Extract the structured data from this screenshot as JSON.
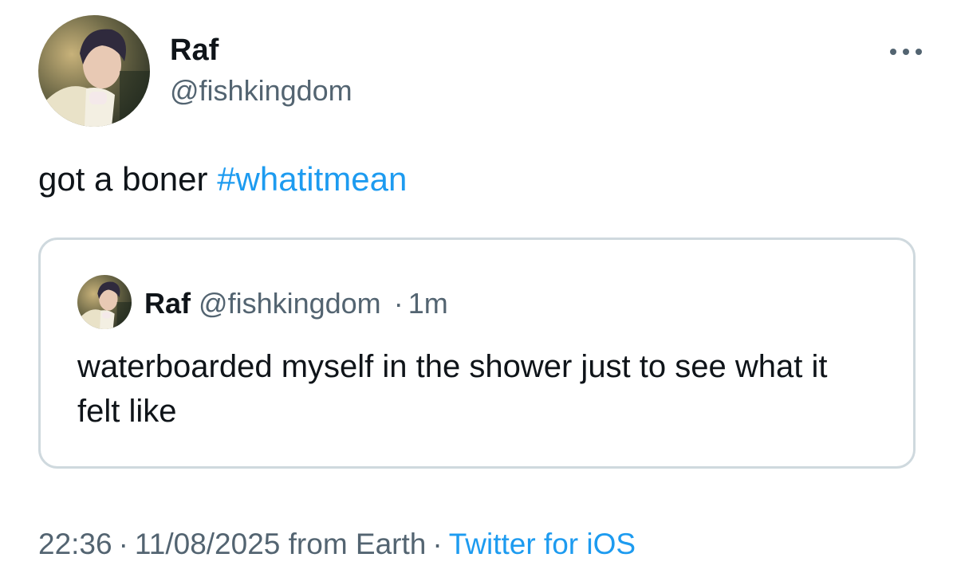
{
  "author": {
    "display_name": "Raf",
    "handle": "@fishkingdom"
  },
  "tweet": {
    "text": "got a boner",
    "hashtag": "#whatitmean"
  },
  "quote_tweet": {
    "display_name": "Raf",
    "handle": "@fishkingdom",
    "separator": "·",
    "time_ago": "1m",
    "text": "waterboarded myself in the shower just to see what it felt like"
  },
  "footer": {
    "time": "22:36",
    "date": "11/08/2025",
    "location": "from Earth",
    "separator": "·",
    "source": "Twitter for iOS"
  },
  "icons": {
    "more": "more-horizontal-icon"
  },
  "colors": {
    "accent": "#1d9bf0",
    "text_primary": "#0f1419",
    "text_secondary": "#536471",
    "border": "#cfd9de"
  }
}
